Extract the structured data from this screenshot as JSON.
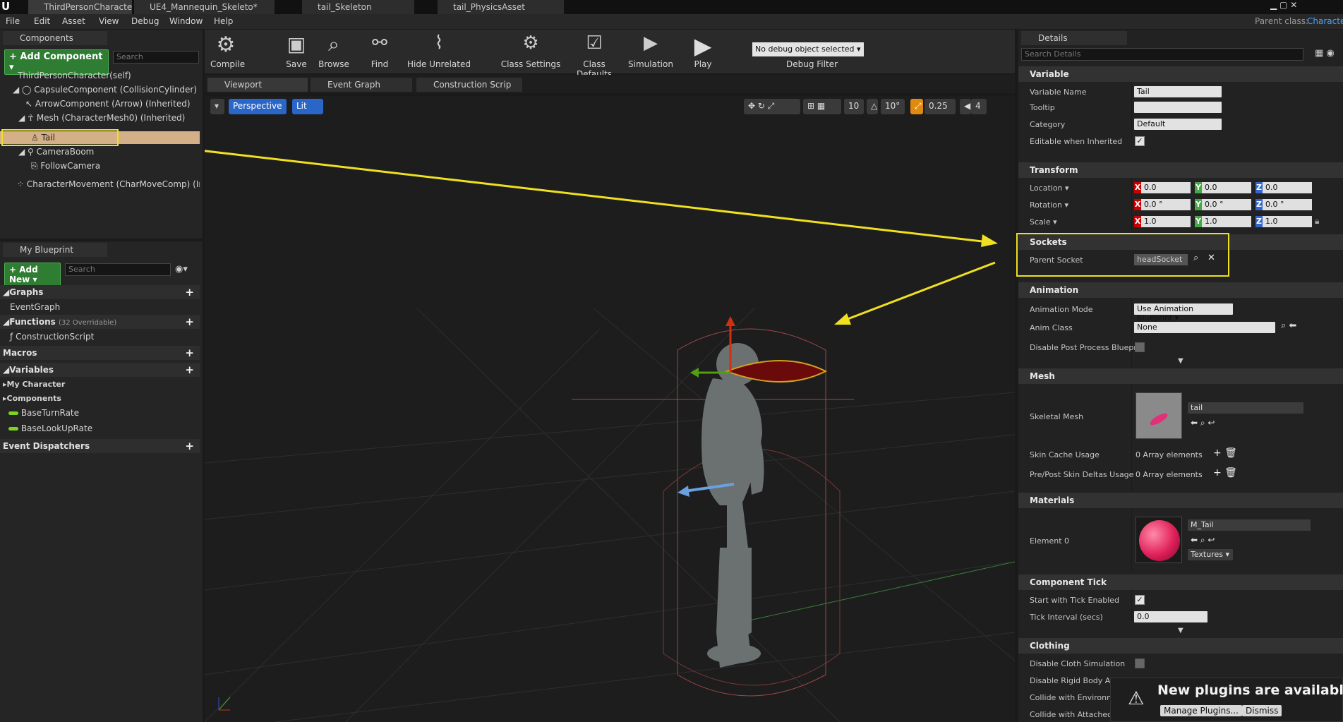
{
  "tabs": [
    {
      "label": "ThirdPersonCharacter*",
      "active": true
    },
    {
      "label": "UE4_Mannequin_Skeleto*",
      "active": false
    },
    {
      "label": "tail_Skeleton",
      "active": false
    },
    {
      "label": "tail_PhysicsAsset",
      "active": false
    }
  ],
  "parent_class": {
    "label": "Parent class:",
    "value": "Characte"
  },
  "menu": [
    "File",
    "Edit",
    "Asset",
    "View",
    "Debug",
    "Window",
    "Help"
  ],
  "components": {
    "title": "Components",
    "add_button": "+ Add Component ▾",
    "search_placeholder": "Search",
    "items": [
      "ThirdPersonCharacter(self)",
      "CapsuleComponent (CollisionCylinder) (Inhe",
      "ArrowComponent (Arrow) (Inherited)",
      "Mesh (CharacterMesh0) (Inherited)",
      "Tail",
      "CameraBoom",
      "FollowCamera",
      "CharacterMovement (CharMoveComp) (Inher"
    ]
  },
  "blueprint": {
    "title": "My Blueprint",
    "add_button": "+ Add New ▾",
    "search_placeholder": "Search",
    "graphs": "Graphs",
    "event_graph": "EventGraph",
    "functions": "Functions",
    "functions_count": "(32 Overridable)",
    "construction_script": "ConstructionScript",
    "macros": "Macros",
    "variables": "Variables",
    "my_character": "My Character",
    "components_cat": "Components",
    "var1": "BaseTurnRate",
    "var2": "BaseLookUpRate",
    "dispatchers": "Event Dispatchers"
  },
  "toolbar": {
    "compile": "Compile",
    "save": "Save",
    "browse": "Browse",
    "find": "Find",
    "hide_unrelated": "Hide Unrelated",
    "class_settings": "Class Settings",
    "class_defaults": "Class Defaults",
    "simulation": "Simulation",
    "play": "Play",
    "debug_select": "No debug object selected ▾",
    "debug_filter": "Debug Filter"
  },
  "editor_tabs": [
    "Viewport",
    "Event Graph",
    "Construction Scrip"
  ],
  "viewport": {
    "perspective": "Perspective",
    "lit": "Lit",
    "grid_snap": "10",
    "rot_snap": "10°",
    "scale_snap": "0.25",
    "cam_speed": "4"
  },
  "details": {
    "title": "Details",
    "search_placeholder": "Search Details",
    "sections": {
      "variable": "Variable",
      "transform": "Transform",
      "sockets": "Sockets",
      "animation": "Animation",
      "mesh": "Mesh",
      "materials": "Materials",
      "component_tick": "Component Tick",
      "clothing": "Clothing"
    },
    "variable_name_label": "Variable Name",
    "variable_name": "Tail",
    "tooltip_label": "Tooltip",
    "category_label": "Category",
    "category": "Default",
    "editable_label": "Editable when Inherited",
    "location_label": "Location ▾",
    "rotation_label": "Rotation ▾",
    "scale_label": "Scale ▾",
    "loc": [
      "0.0",
      "0.0",
      "0.0"
    ],
    "rot": [
      "0.0 °",
      "0.0 °",
      "0.0 °"
    ],
    "scale": [
      "1.0",
      "1.0",
      "1.0"
    ],
    "axes": [
      "X",
      "Y",
      "Z"
    ],
    "parent_socket_label": "Parent Socket",
    "parent_socket": "headSocket",
    "anim_mode_label": "Animation Mode",
    "anim_mode": "Use Animation Blueprint ▾",
    "anim_class_label": "Anim Class",
    "anim_class": "None",
    "disable_pp_label": "Disable Post Process Bluepri",
    "skeletal_mesh_label": "Skeletal Mesh",
    "skeletal_mesh": "tail",
    "skin_cache_label": "Skin Cache Usage",
    "skin_cache": "0 Array elements",
    "skin_deltas_label": "Pre/Post Skin Deltas Usage",
    "skin_deltas": "0 Array elements",
    "element0_label": "Element 0",
    "material": "M_Tail",
    "textures": "Textures ▾",
    "tick_enabled_label": "Start with Tick Enabled",
    "tick_interval_label": "Tick Interval (secs)",
    "tick_interval": "0.0",
    "cloth1": "Disable Cloth Simulation",
    "cloth2": "Disable Rigid Body Ani",
    "cloth3": "Collide with Environme",
    "cloth4": "Collide with Attached C"
  },
  "toast": {
    "title": "New plugins are available",
    "manage": "Manage Plugins...",
    "dismiss": "Dismiss"
  },
  "colors": {
    "highlight": "#f0e020",
    "accent_green": "#2e7d32",
    "selection": "#d4b088"
  }
}
